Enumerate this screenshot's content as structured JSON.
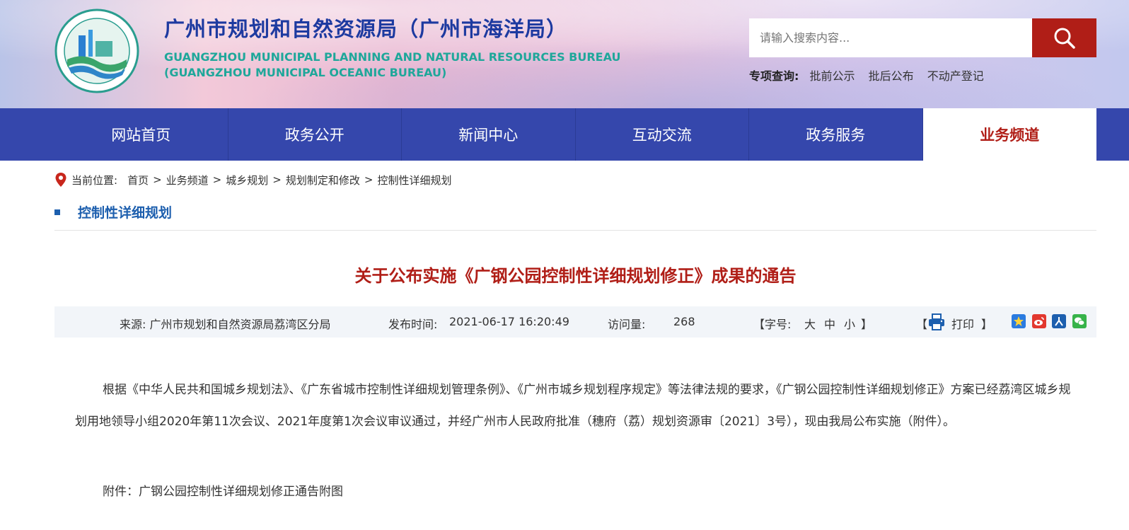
{
  "header": {
    "title_cn": "广州市规划和自然资源局（广州市海洋局）",
    "title_en_line1": "GUANGZHOU MUNICIPAL PLANNING AND NATURAL RESOURCES BUREAU",
    "title_en_line2": "(GUANGZHOU MUNICIPAL OCEANIC BUREAU)",
    "search_placeholder": "请输入搜索内容...",
    "special_label": "专项查询:",
    "special_links": [
      "批前公示",
      "批后公布",
      "不动产登记"
    ]
  },
  "nav": {
    "items": [
      "网站首页",
      "政务公开",
      "新闻中心",
      "互动交流",
      "政务服务",
      "业务频道"
    ],
    "active": "业务频道"
  },
  "breadcrumb": {
    "label": "当前位置:",
    "items": [
      "首页",
      "业务频道",
      "城乡规划",
      "规划制定和修改",
      "控制性详细规划"
    ]
  },
  "section_title": "控制性详细规划",
  "article": {
    "title": "关于公布实施《广钢公园控制性详细规划修正》成果的通告",
    "meta": {
      "source": "来源: 广州市规划和自然资源局荔湾区分局",
      "publish_label": "发布时间:",
      "publish_time": "2021-06-17 16:20:49",
      "views_label": "访问量:",
      "views": "268",
      "font_label": "【字号:",
      "font_big": "大",
      "font_mid": "中",
      "font_small": "小",
      "font_end": "】",
      "print_open": "【",
      "print_label": "打印",
      "print_close": "】"
    },
    "body": "根据《中华人民共和国城乡规划法》、《广东省城市控制性详细规划管理条例》、《广州市城乡规划程序规定》等法律法规的要求，《广钢公园控制性详细规划修正》方案已经荔湾区城乡规划用地领导小组2020年第11次会议、2021年度第1次会议审议通过，并经广州市人民政府批准（穗府（荔）规划资源审〔2021〕3号），现由我局公布实施（附件）。",
    "attachment": "附件：广钢公园控制性详细规划修正通告附图"
  },
  "colors": {
    "nav_blue": "#3547ac",
    "accent_red": "#b01e17",
    "title_blue": "#1d3aa0",
    "en_green": "#1fa79a"
  }
}
